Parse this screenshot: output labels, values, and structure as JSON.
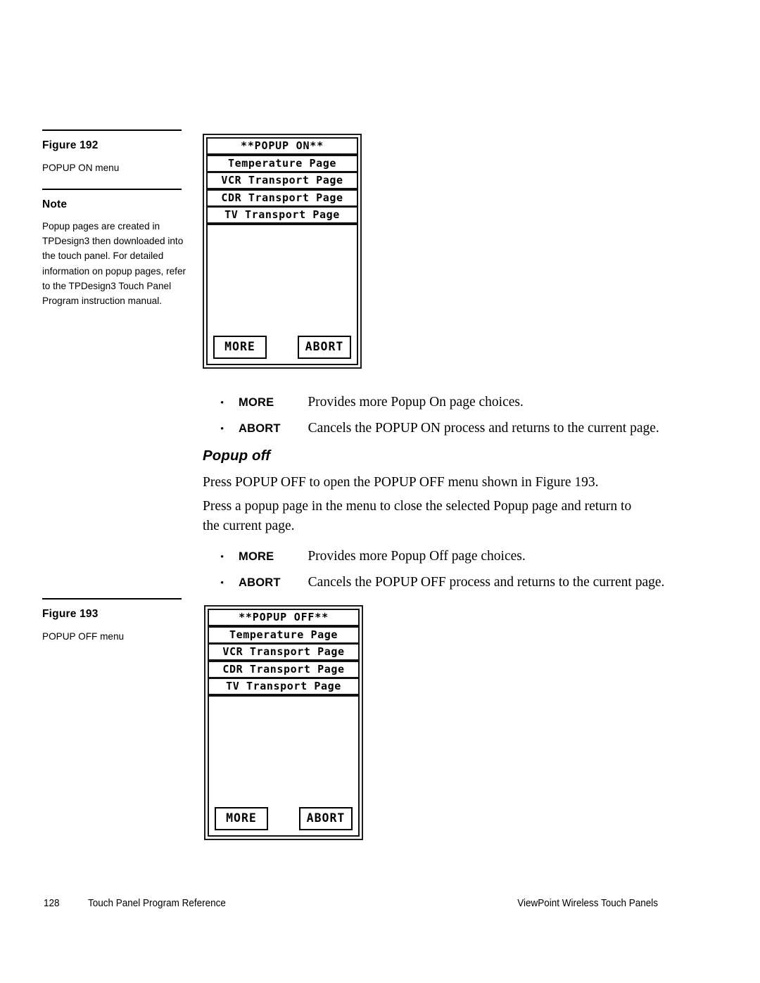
{
  "figure192": {
    "rule_top": true,
    "heading": "Figure 192",
    "caption": "POPUP ON menu",
    "note_heading": "Note",
    "note_body": "Popup pages are created in TPDesign3 then downloaded into the touch panel. For detailed information on popup pages, refer to the TPDesign3 Touch Panel Program instruction manual."
  },
  "panel_on": {
    "title": "**POPUP ON**",
    "rows": [
      "Temperature Page",
      "VCR Transport Page",
      "CDR Transport Page",
      "TV Transport Page"
    ],
    "buttons": {
      "more": "MORE",
      "abort": "ABORT"
    }
  },
  "bullets_on": [
    {
      "marker": "•",
      "term": "MORE",
      "definition": "Provides more Popup On page choices."
    },
    {
      "marker": "•",
      "term": "ABORT",
      "definition": "Cancels the POPUP ON process and returns to the current page."
    }
  ],
  "section": {
    "heading": "Popup off",
    "para1": "Press POPUP OFF to open the POPUP OFF menu shown in Figure 193.",
    "para2": "Press a popup page in the menu to close the selected Popup page and return to the current page."
  },
  "bullets_off": [
    {
      "marker": "•",
      "term": "MORE",
      "definition": "Provides more Popup Off page choices."
    },
    {
      "marker": "•",
      "term": "ABORT",
      "definition": "Cancels the POPUP OFF process and returns to the current page."
    }
  ],
  "figure193": {
    "heading": "Figure 193",
    "caption": "POPUP OFF menu"
  },
  "panel_off": {
    "title": "**POPUP OFF**",
    "rows": [
      "Temperature Page",
      "VCR Transport Page",
      "CDR Transport Page",
      "TV Transport Page"
    ],
    "buttons": {
      "more": "MORE",
      "abort": "ABORT"
    }
  },
  "footer": {
    "page_number": "128",
    "left_text": "Touch Panel Program Reference",
    "right_text": "ViewPoint Wireless Touch Panels"
  }
}
